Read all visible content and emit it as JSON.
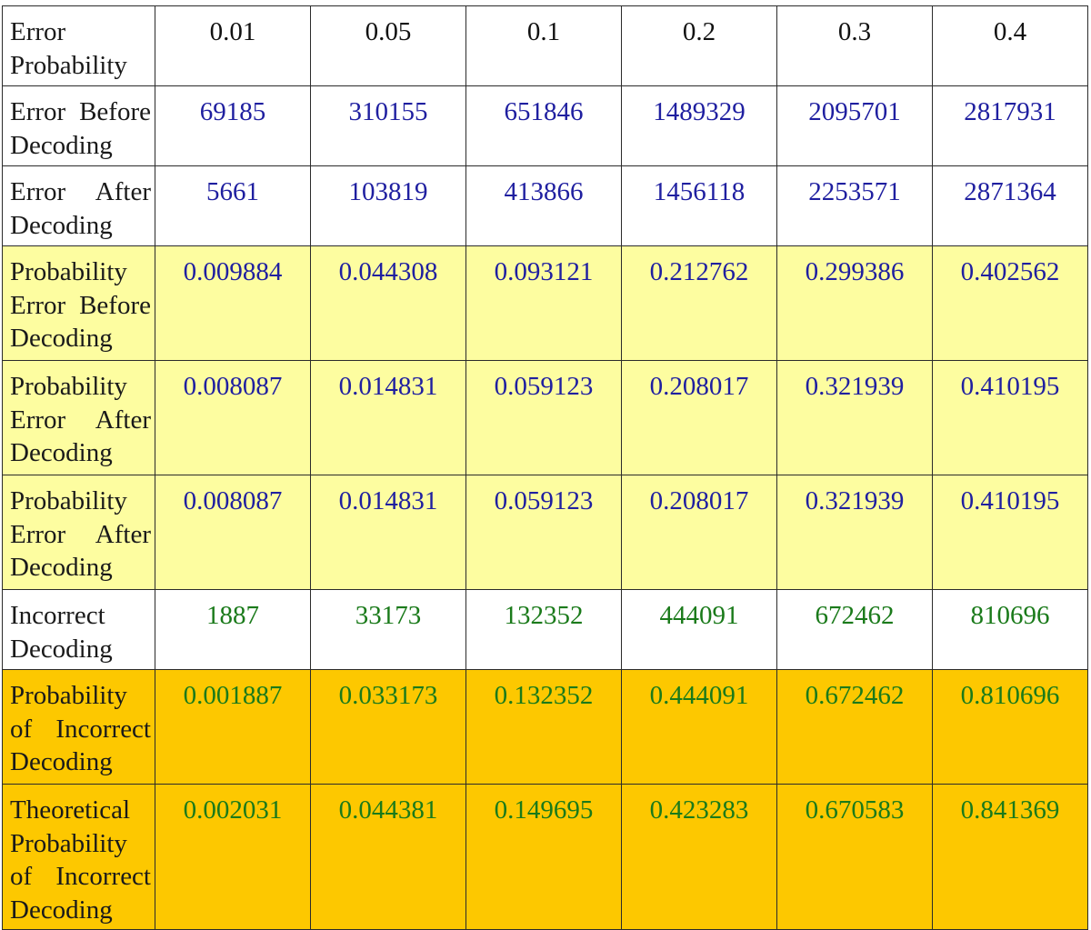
{
  "table": {
    "header": {
      "label": "Error Probability",
      "values": [
        "0.01",
        "0.05",
        "0.1",
        "0.2",
        "0.3",
        "0.4"
      ]
    },
    "rows": [
      {
        "label": "Error Before Decoding",
        "values": [
          "69185",
          "310155",
          "651846",
          "1489329",
          "2095701",
          "2817931"
        ]
      },
      {
        "label": "Error After Decoding",
        "values": [
          "5661",
          "103819",
          "413866",
          "1456118",
          "2253571",
          "2871364"
        ]
      },
      {
        "label": "Probability Error Before Decoding",
        "values": [
          "0.009884",
          "0.044308",
          "0.093121",
          "0.212762",
          "0.299386",
          "0.402562"
        ]
      },
      {
        "label": "Probability Error After Decoding",
        "values": [
          "0.008087",
          "0.014831",
          "0.059123",
          "0.208017",
          "0.321939",
          "0.410195"
        ]
      },
      {
        "label": "Probability Error After Decoding",
        "values": [
          "0.008087",
          "0.014831",
          "0.059123",
          "0.208017",
          "0.321939",
          "0.410195"
        ]
      },
      {
        "label": "Incorrect Decoding",
        "values": [
          "1887",
          "33173",
          "132352",
          "444091",
          "672462",
          "810696"
        ]
      },
      {
        "label": "Probability of Incorrect Decoding",
        "values": [
          "0.001887",
          "0.033173",
          "0.132352",
          "0.444091",
          "0.672462",
          "0.810696"
        ]
      },
      {
        "label": "Theoretical Probability of Incorrect Decoding",
        "values": [
          "0.002031",
          "0.044381",
          "0.149695",
          "0.423283",
          "0.670583",
          "0.841369"
        ]
      }
    ]
  },
  "colors": {
    "yellow_fill": "#fdfda0",
    "orange_fill": "#fdc800",
    "blue_text": "#1f1fa0",
    "green_text": "#1a7a1a"
  }
}
